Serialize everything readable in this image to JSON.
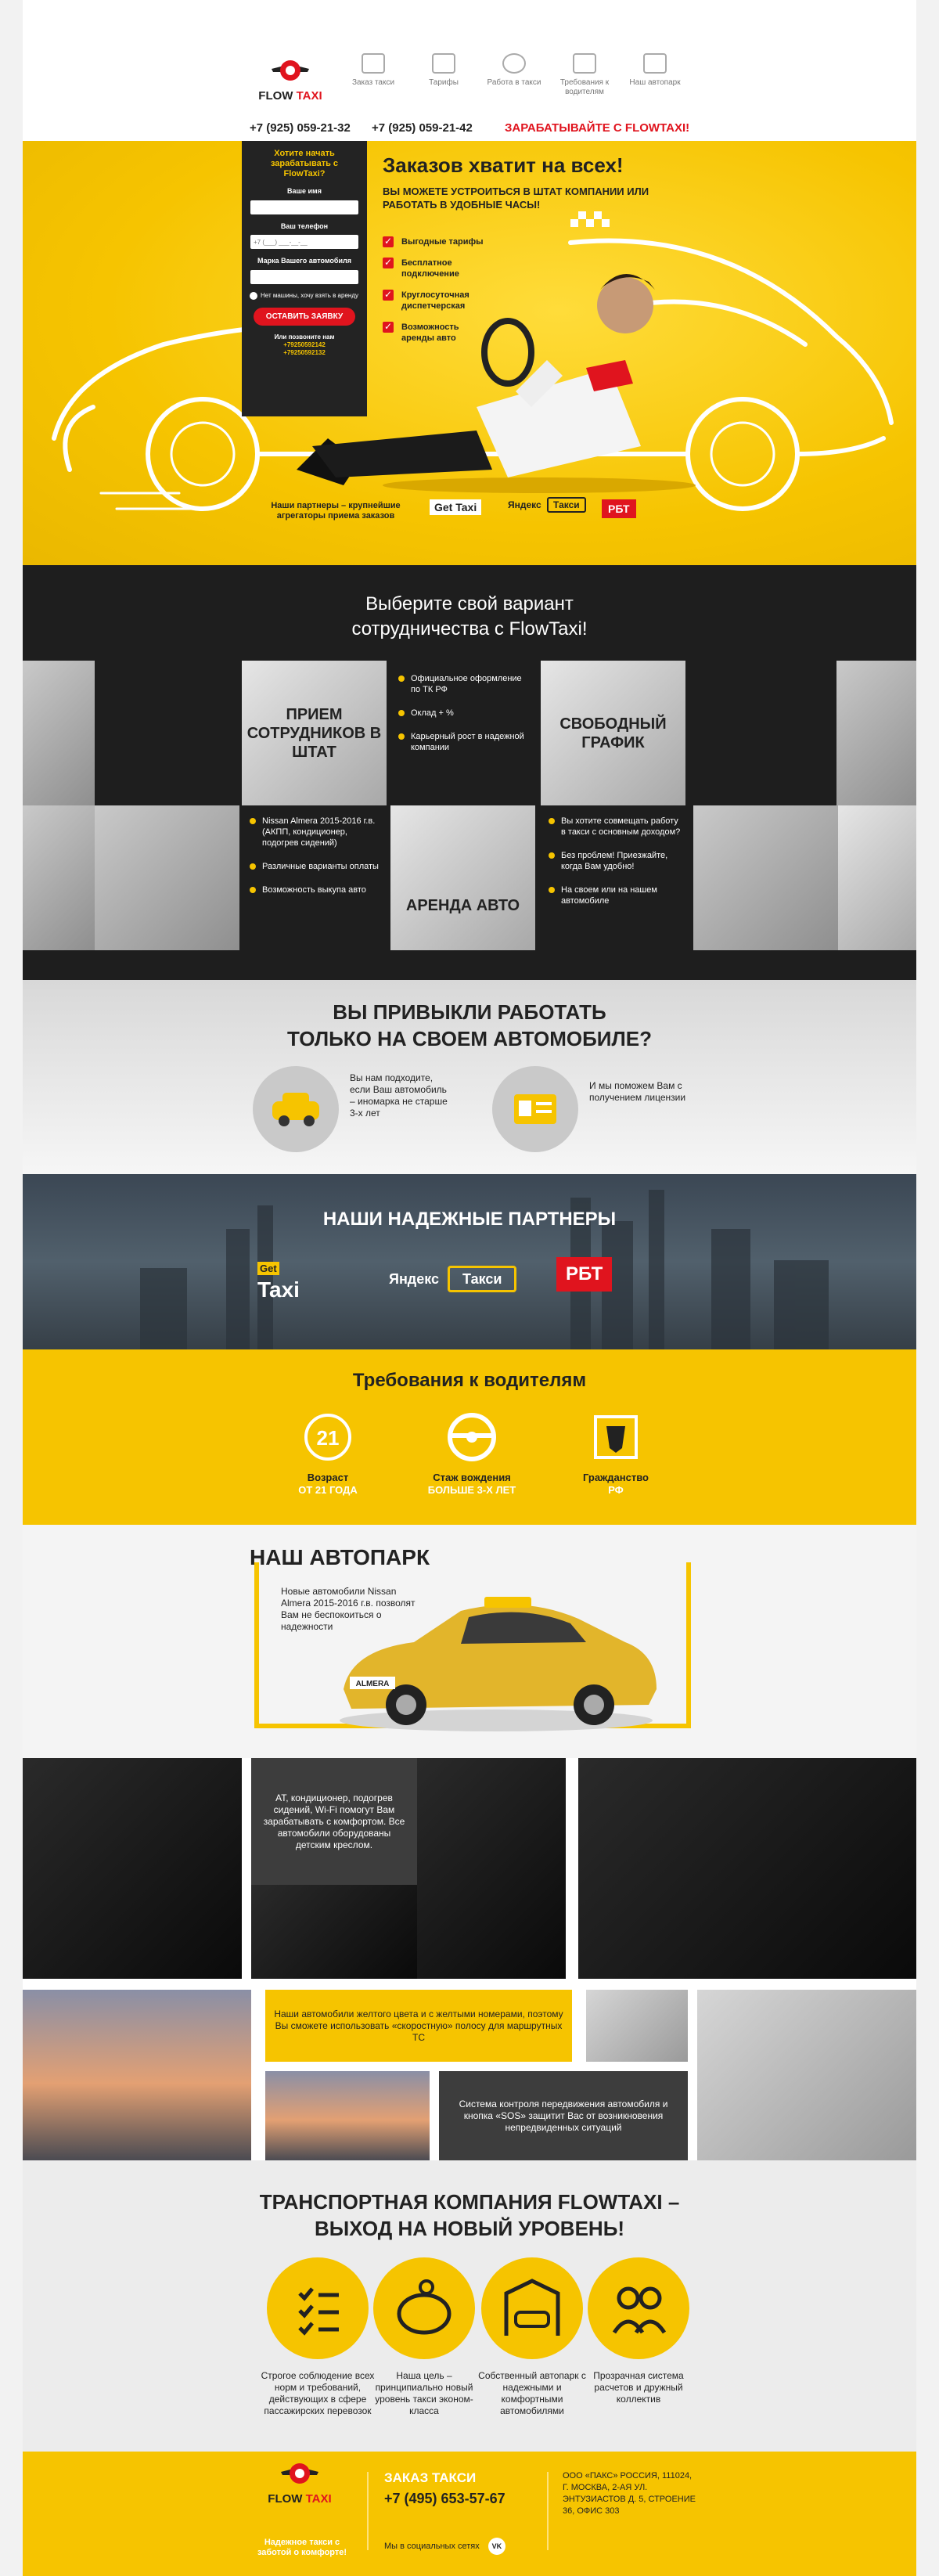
{
  "header": {
    "logo_text_a": "FLOW",
    "logo_text_b": "TAXI",
    "nav": [
      {
        "label": "Заказ такси",
        "icon": "car-icon"
      },
      {
        "label": "Тарифы",
        "icon": "wallet-icon"
      },
      {
        "label": "Работа в такси",
        "icon": "driver-icon"
      },
      {
        "label": "Требования к водителям",
        "icon": "id-card-icon"
      },
      {
        "label": "Наш автопарк",
        "icon": "garage-icon"
      }
    ],
    "phone1": "+7 (925) 059-21-32",
    "phone2": "+7 (925) 059-21-42",
    "cta": "ЗАРАБАТЫВАЙТЕ С FLOWTAXI!"
  },
  "form": {
    "title": "Хотите начать зарабатывать с FlowTaxi?",
    "name_label": "Ваше имя",
    "phone_label": "Ваш телефон",
    "phone_placeholder": "+7 (___) ___-__-__",
    "car_label": "Марка Вашего автомобиля",
    "no_car": "Нет машины, хочу взять в аренду",
    "submit": "ОСТАВИТЬ ЗАЯВКУ",
    "call_us": "Или позвоните нам",
    "call_phone1": "+79250592142",
    "call_phone2": "+79250592132"
  },
  "hero": {
    "title": "Заказов хватит на всех!",
    "subtitle": "ВЫ МОЖЕТЕ УСТРОИТЬСЯ В ШТАТ КОМПАНИИ ИЛИ РАБОТАТЬ В УДОБНЫЕ ЧАСЫ!",
    "benefits": [
      "Выгодные тарифы",
      "Бесплатное подключение",
      "Круглосуточная диспетчерская",
      "Возможность аренды авто"
    ],
    "partners_text": "Наши партнеры – крупнейшие агрегаторы приема заказов",
    "partner_gettaxi": "Get Taxi",
    "partner_yandex": "Яндекс",
    "partner_yandex2": "Такси",
    "partner_rbt": "РБТ"
  },
  "coop": {
    "title_line1": "Выберите свой вариант",
    "title_line2": "сотрудничества с FlowTaxi!",
    "staff": "ПРИЕМ СОТРУДНИКОВ В ШТАТ",
    "free": "СВОБОДНЫЙ ГРАФИК",
    "rent": "АРЕНДА АВТО",
    "staff_points": [
      "Официальное оформление по ТК РФ",
      "Оклад + %",
      "Карьерный рост в надежной компании"
    ],
    "rent_points": [
      "Nissan Almera 2015-2016 г.в. (АКПП, кондиционер, подогрев сидений)",
      "Различные варианты оплаты",
      "Возможность выкупа авто"
    ],
    "free_points": [
      "Вы хотите совмещать работу в такси с основным доходом?",
      "Без проблем! Приезжайте, когда Вам удобно!",
      "На своем или на нашем автомобиле"
    ]
  },
  "own": {
    "title_line1": "ВЫ ПРИВЫКЛИ РАБОТАТЬ",
    "title_line2": "ТОЛЬКО НА СВОЕМ АВТОМОБИЛЕ?",
    "left": "Вы нам подходите, если Ваш автомобиль – иномарка не старше 3-х лет",
    "right": "И мы поможем Вам с получением лицензии"
  },
  "partners": {
    "title": "НАШИ НАДЕЖНЫЕ ПАРТНЕРЫ",
    "gettaxi_a": "Get",
    "gettaxi_b": "Taxi",
    "yandex": "Яндекс",
    "yandex2": "Такси",
    "rbt": "РБТ"
  },
  "requirements": {
    "title": "Требования к водителям",
    "age_icon": "21",
    "items": [
      {
        "a": "Возраст",
        "b": "ОТ 21 ГОДА"
      },
      {
        "a": "Стаж вождения",
        "b": "БОЛЬШЕ 3-Х ЛЕТ"
      },
      {
        "a": "Гражданство",
        "b": "РФ"
      }
    ]
  },
  "park": {
    "title": "НАШ АВТОПАРК",
    "desc": "Новые автомобили Nissan Almera 2015-2016 г.в. позволят Вам не беспокоиться о надежности",
    "plate": "ALMERA"
  },
  "gallery": {
    "t1": "AT, кондиционер, подогрев сидений, Wi-Fi помогут Вам зарабатывать с комфортом. Все автомобили оборудованы детским креслом.",
    "t2": "Наши автомобили желтого цвета и с желтыми номерами, поэтому Вы сможете использовать «скоростную» полосу для маршрутных ТС",
    "t3": "Система контроля передвижения автомобиля и кнопка «SOS» защитит Вас от возникновения непредвиденных ситуаций"
  },
  "company": {
    "title_line1": "ТРАНСПОРТНАЯ КОМПАНИЯ FLOWTAXI –",
    "title_line2": "ВЫХОД НА НОВЫЙ УРОВЕНЬ!",
    "items": [
      "Строгое соблюдение всех норм и требований, действующих в сфере пассажирских перевозок",
      "Наша цель – принципиально новый уровень такси эконом-класса",
      "Собственный автопарк с надежными и комфортными автомобилями",
      "Прозрачная система расчетов и дружный коллектив"
    ]
  },
  "footer": {
    "logo_a": "FLOW",
    "logo_b": "TAXI",
    "slogan": "Надежное такси с заботой о комфорте!",
    "order": "ЗАКАЗ ТАКСИ",
    "phone": "+7 (495) 653-57-67",
    "social": "Мы в социальных сетях",
    "social_icon": "VK",
    "address": "ООО «ПАКС» РОССИЯ, 111024, Г. МОСКВА, 2-АЯ УЛ. ЭНТУЗИАСТОВ Д. 5, СТРОЕНИЕ 36, ОФИС 303"
  }
}
